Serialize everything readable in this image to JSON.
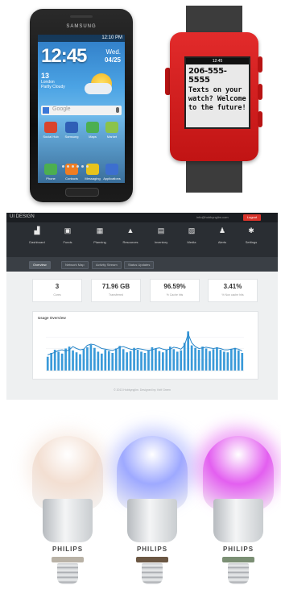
{
  "phone": {
    "brand": "SAMSUNG",
    "status_time": "12:10 PM",
    "clock": "12:45",
    "date_day": "Wed.",
    "date_md": "04/25",
    "weather_temp": "13",
    "weather_city": "London",
    "weather_desc": "Partly Cloudy",
    "search_placeholder": "Google",
    "apps_row1": [
      "Social Hub",
      "Samsung",
      "Maps",
      "Market"
    ],
    "apps_row2": [
      "Phone",
      "Contacts",
      "Messaging",
      "Applications"
    ]
  },
  "watch": {
    "status": "12:45",
    "number": "206-555-5555",
    "message": "Texts on your watch? Welcome to the future!"
  },
  "dashboard": {
    "app_title": "UI DESIGN",
    "account_email": "info@hobbynglim.com",
    "logout_label": "Logout",
    "nav": [
      {
        "label": "Dashboard",
        "icon": "chart-icon"
      },
      {
        "label": "Funds",
        "icon": "wallet-icon"
      },
      {
        "label": "Planning",
        "icon": "calendar-icon"
      },
      {
        "label": "Resources",
        "icon": "flask-icon"
      },
      {
        "label": "Inventory",
        "icon": "box-icon"
      },
      {
        "label": "Media",
        "icon": "image-icon"
      },
      {
        "label": "Alerts",
        "icon": "bell-icon"
      },
      {
        "label": "Settings",
        "icon": "gear-icon"
      }
    ],
    "subtabs": [
      "Overview",
      "Network Map",
      "Activity Stream",
      "Status Updates"
    ],
    "stats": [
      {
        "value": "3",
        "label": "Cores"
      },
      {
        "value": "71.96 GB",
        "label": "Transferred"
      },
      {
        "value": "96.59%",
        "label": "% Cache hits"
      },
      {
        "value": "3.41%",
        "label": "% Non cache hits"
      }
    ],
    "chart_title": "Usage Overview",
    "footer": "© 2013 Hobbynglim. Designed by: Keif Green"
  },
  "chart_data": {
    "type": "bar",
    "title": "Usage Overview",
    "values": [
      22,
      28,
      33,
      30,
      27,
      35,
      38,
      32,
      29,
      26,
      34,
      37,
      41,
      36,
      30,
      27,
      33,
      31,
      28,
      35,
      39,
      34,
      29,
      31,
      36,
      33,
      30,
      28,
      32,
      37,
      35,
      31,
      29,
      33,
      38,
      34,
      30,
      32,
      44,
      62,
      40,
      36,
      33,
      38,
      35,
      31,
      34,
      37,
      33,
      30,
      29,
      34,
      36,
      32,
      28
    ],
    "line_values": [
      25,
      27,
      29,
      32,
      33,
      31,
      33,
      38,
      35,
      33,
      34,
      40,
      42,
      41,
      38,
      35,
      34,
      33,
      32,
      34,
      37,
      38,
      36,
      34,
      33,
      35,
      34,
      33,
      32,
      33,
      35,
      36,
      34,
      33,
      34,
      37,
      36,
      34,
      40,
      58,
      44,
      38,
      35,
      36,
      37,
      36,
      35,
      36,
      35,
      33,
      33,
      34,
      35,
      34,
      31
    ],
    "ylim": [
      0,
      70
    ],
    "bar_color": "#3a9ad9",
    "line_color": "#2a86c8"
  },
  "bulbs": [
    {
      "brand": "PHILIPS",
      "glow": "#f3dfd2",
      "ring": "#b9b2a6"
    },
    {
      "brand": "PHILIPS",
      "glow": "#9ea9ff",
      "ring": "#6b5743"
    },
    {
      "brand": "PHILIPS",
      "glow": "#e35ff0",
      "ring": "#7b8f74"
    }
  ]
}
